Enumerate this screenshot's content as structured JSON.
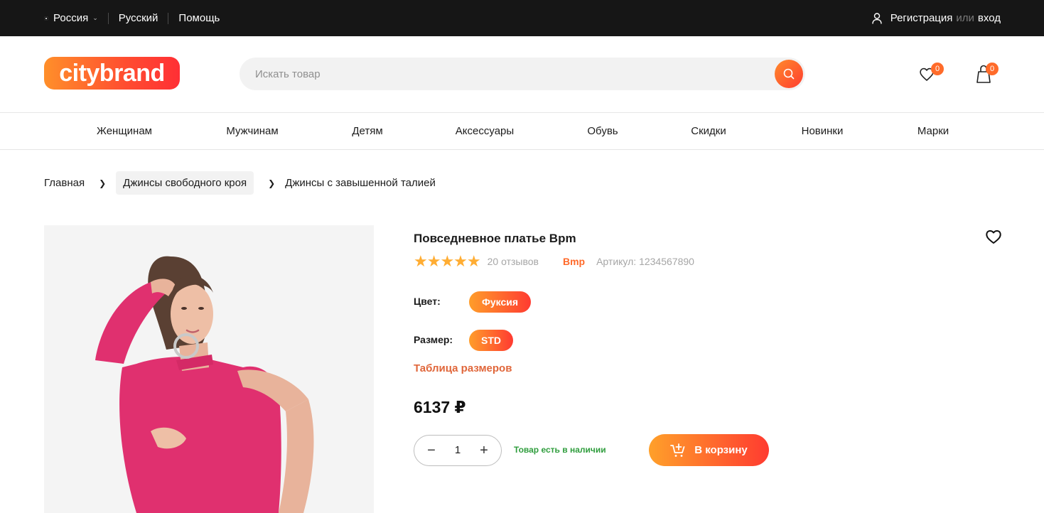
{
  "topbar": {
    "region": "Россия",
    "language": "Русский",
    "help": "Помощь",
    "register": "Регистрация",
    "or": "или",
    "login": "вход"
  },
  "header": {
    "logo": "citybrand",
    "search_placeholder": "Искать товар",
    "favorites_count": "0",
    "cart_count": "0"
  },
  "nav": {
    "items": [
      "Женщинам",
      "Мужчинам",
      "Детям",
      "Аксессуары",
      "Обувь",
      "Скидки",
      "Новинки",
      "Марки"
    ]
  },
  "breadcrumb": {
    "home": "Главная",
    "category": "Джинсы свободного кроя",
    "current": "Джинсы с завышенной талией"
  },
  "product": {
    "title": "Повседневное платье Bpm",
    "rating_stars": "★★★★★",
    "rating": 5,
    "reviews": "20 отзывов",
    "brand": "Bmp",
    "sku": "Артикул: 1234567890",
    "color_label": "Цвет:",
    "color_value": "Фуксия",
    "size_label": "Размер:",
    "size_value": "STD",
    "size_table_link": "Таблица размеров",
    "price": "6137 ₽",
    "quantity": "1",
    "stock_status": "Товар есть в наличии",
    "add_to_cart": "В корзину"
  },
  "colors": {
    "accent": "#ff6a2a",
    "topbar_bg": "#161616",
    "star": "#ffad33",
    "stock_green": "#2f9d3d",
    "dress": "#e0306f"
  }
}
